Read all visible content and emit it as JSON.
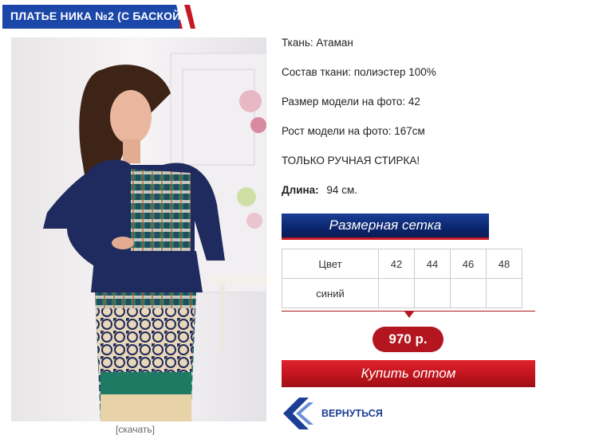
{
  "product": {
    "title": "ПЛАТЬЕ НИКА №2 (С БАСКОЙ)",
    "zoom_label": "[скачать]"
  },
  "details": {
    "fabric": "Ткань: Атаман",
    "composition": "Состав ткани: полиэстер 100%",
    "model_size": "Размер модели на фото: 42",
    "model_height": "Рост модели на фото: 167см",
    "wash_note": "ТОЛЬКО РУЧНАЯ СТИРКА!",
    "length_label": "Длина:",
    "length_value": "94 см."
  },
  "size_chart_button": "Размерная сетка",
  "size_table": {
    "header": [
      "Цвет",
      "42",
      "44",
      "46",
      "48"
    ],
    "row": [
      "синий",
      "",
      "",
      "",
      ""
    ]
  },
  "price": "970 р.",
  "buy_button": "Купить оптом",
  "back_link": "ВЕРНУТЬСЯ",
  "colors": {
    "brand_blue": "#0e2a74",
    "brand_red": "#b3161f"
  }
}
